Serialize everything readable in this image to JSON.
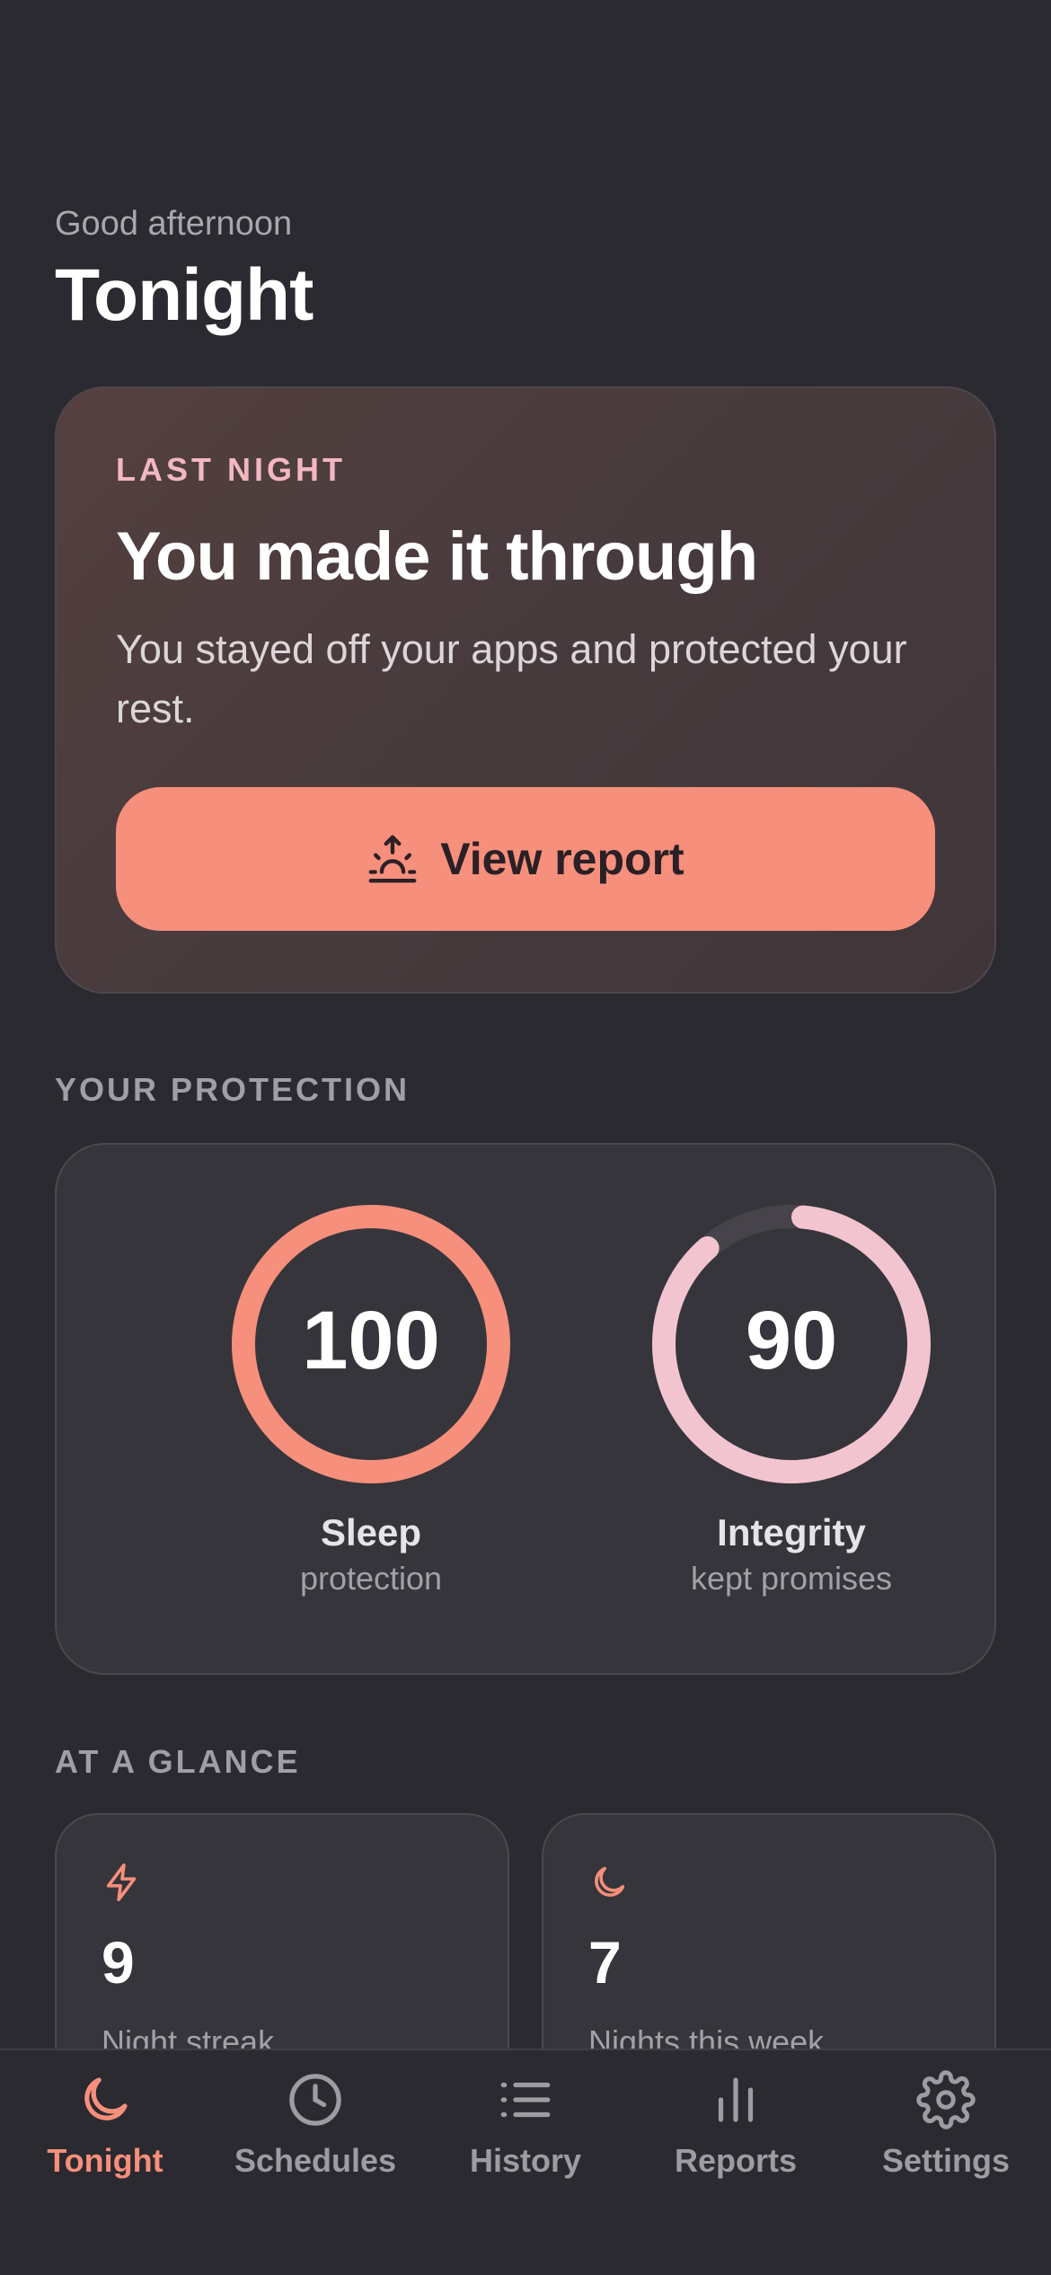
{
  "header": {
    "greeting": "Good afternoon",
    "title": "Tonight"
  },
  "hero": {
    "eyebrow": "LAST NIGHT",
    "title": "You made it through",
    "subtitle": "You stayed off your apps and protected your rest.",
    "button_label": "View report",
    "button_icon": "sunrise-icon"
  },
  "protection": {
    "section_label": "YOUR PROTECTION",
    "rings": [
      {
        "value": "100",
        "percent": 100,
        "label": "Sleep",
        "sublabel": "protection",
        "color": "#f68f7b"
      },
      {
        "value": "90",
        "percent": 90,
        "label": "Integrity",
        "sublabel": "kept promises",
        "color": "#f2c4cf"
      }
    ]
  },
  "glance": {
    "section_label": "AT A GLANCE",
    "cards": [
      {
        "icon": "lightning-icon",
        "value": "9",
        "label": "Night streak"
      },
      {
        "icon": "moon-icon",
        "value": "7",
        "label": "Nights this week"
      }
    ]
  },
  "tabs": [
    {
      "label": "Tonight",
      "icon": "moon-icon",
      "active": true
    },
    {
      "label": "Schedules",
      "icon": "clock-icon",
      "active": false
    },
    {
      "label": "History",
      "icon": "list-icon",
      "active": false
    },
    {
      "label": "Reports",
      "icon": "bar-chart-icon",
      "active": false
    },
    {
      "label": "Settings",
      "icon": "gear-icon",
      "active": false
    }
  ],
  "colors": {
    "accent": "#f68f7b",
    "accent_secondary": "#f2c4cf",
    "background": "#2b2a30",
    "card": "#36353b"
  }
}
